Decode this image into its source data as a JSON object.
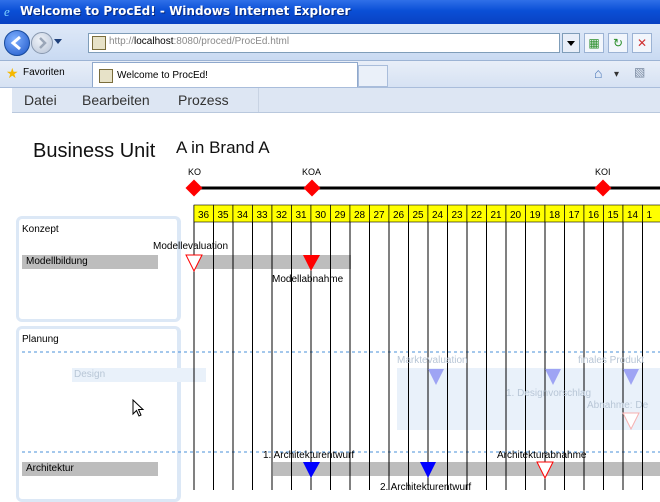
{
  "window": {
    "title": "Welcome to ProcEd! - Windows Internet Explorer"
  },
  "address": {
    "url_prefix": "http://",
    "url_host": "localhost",
    "url_rest": ":8080/proced/ProcEd.html"
  },
  "favorites": {
    "label": "Favoriten"
  },
  "tab": {
    "title": "Welcome to ProcEd!"
  },
  "menu": {
    "items": [
      "Datei",
      "Bearbeiten",
      "Prozess"
    ]
  },
  "header": {
    "title": "Business Unit",
    "subtitle": "A in Brand A"
  },
  "milestones": [
    {
      "label": "KO"
    },
    {
      "label": "KOA"
    },
    {
      "label": "KOI"
    }
  ],
  "timeline": {
    "weeks": [
      "36",
      "35",
      "34",
      "33",
      "32",
      "31",
      "30",
      "29",
      "28",
      "27",
      "26",
      "25",
      "24",
      "23",
      "22",
      "21",
      "20",
      "19",
      "18",
      "17",
      "16",
      "15",
      "14",
      "1"
    ]
  },
  "lanes": [
    {
      "label": "Konzept",
      "row_label": "Modellbildung"
    },
    {
      "label": "Planung",
      "row_label": "Design"
    },
    {
      "label": "",
      "row_label": "Architektur"
    }
  ],
  "annotations": {
    "modellevaluation": "Modellevaluation",
    "modellabnahme": "Modellabnahme",
    "marktevaluation": "Marktevaluation",
    "finales_produkt": "finales Produkt",
    "designvorschlag": "1. Designvorschlag",
    "abnahme_de": "Abnahme: De",
    "architekturentwurf1": "1. Architekturentwurf",
    "architekturabnahme": "Architekturabnahme",
    "architekturentwurf2": "2. Architekturentwurf"
  },
  "colors": {
    "accent": "#ffff00",
    "milestone": "#ff0000",
    "blue_marker": "#0000ff"
  }
}
